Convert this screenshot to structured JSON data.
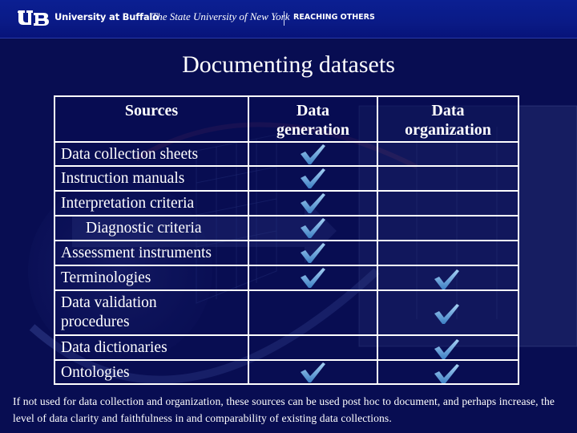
{
  "header": {
    "logo": "UB",
    "university": "University at Buffalo",
    "system": "The State University of New York",
    "tagline": "REACHING OTHERS"
  },
  "slide": {
    "title": "Documenting datasets"
  },
  "table": {
    "columns": [
      "Sources",
      "Data generation",
      "Data organization"
    ],
    "check_icon": "checkmark-icon",
    "rows": [
      {
        "source": "Data collection sheets",
        "data_generation": true,
        "data_organization": false
      },
      {
        "source": "Instruction manuals",
        "data_generation": true,
        "data_organization": false
      },
      {
        "source": "Interpretation criteria",
        "data_generation": true,
        "data_organization": false
      },
      {
        "source": "Diagnostic criteria",
        "data_generation": true,
        "data_organization": false,
        "indented": true
      },
      {
        "source": "Assessment instruments",
        "data_generation": true,
        "data_organization": false
      },
      {
        "source": "Terminologies",
        "data_generation": true,
        "data_organization": true
      },
      {
        "source": "Data validation procedures",
        "data_generation": false,
        "data_organization": true
      },
      {
        "source": "Data dictionaries",
        "data_generation": false,
        "data_organization": true
      },
      {
        "source": "Ontologies",
        "data_generation": true,
        "data_organization": true
      }
    ]
  },
  "footnote": "If not used for data collection and organization, these sources can be used post hoc to document, and perhaps increase, the level of data clarity and faithfulness in and comparability of existing data collections.",
  "colors": {
    "background": "#080d52",
    "header_bar": "#0a1a86",
    "check": "#6aa8e0",
    "border": "#ffffff"
  }
}
